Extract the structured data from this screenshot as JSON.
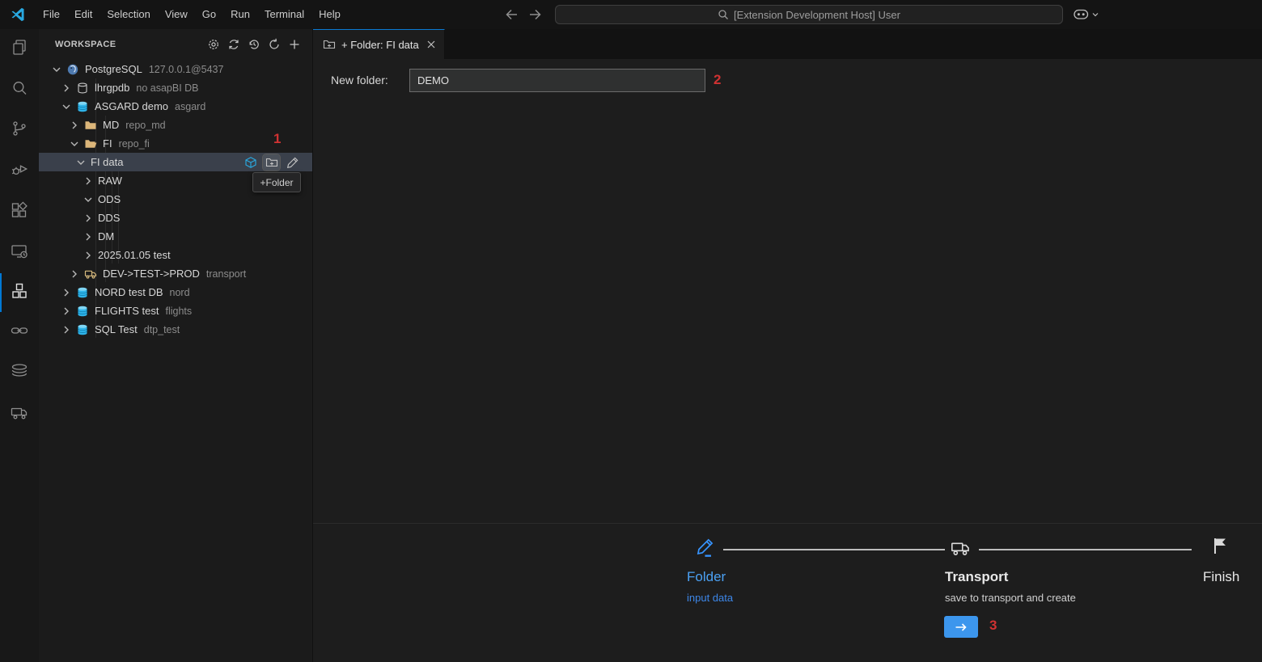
{
  "titlebar": {
    "menu": [
      "File",
      "Edit",
      "Selection",
      "View",
      "Go",
      "Run",
      "Terminal",
      "Help"
    ],
    "command_center": "[Extension Development Host] User",
    "icons": [
      "vscode-logo",
      "back-arrow",
      "forward-arrow",
      "search",
      "copilot",
      "chevron-down"
    ]
  },
  "activity_bar": {
    "icons": [
      "explorer",
      "search",
      "source-control",
      "run-and-debug",
      "extensions",
      "remote-explorer",
      "cubes-extension",
      "link",
      "data-layers",
      "transport-truck"
    ],
    "active": "cubes-extension"
  },
  "sidebar": {
    "title": "WORKSPACE",
    "toolbar_icons": [
      "settings-gear",
      "sync",
      "history",
      "refresh",
      "add"
    ],
    "tooltip": "+Folder",
    "selected_row_actions": [
      "cube",
      "new-folder",
      "edit-pencil"
    ],
    "tree": [
      {
        "level": 0,
        "chevron": "down",
        "icon": "postgres",
        "label": "PostgreSQL",
        "description": "127.0.0.1@5437",
        "selected": false
      },
      {
        "level": 1,
        "chevron": "right",
        "icon": "db-outline",
        "label": "lhrgpdb",
        "description": "no asapBI DB",
        "selected": false
      },
      {
        "level": 1,
        "chevron": "down",
        "icon": "db",
        "label": "ASGARD demo",
        "description": "asgard",
        "selected": false
      },
      {
        "level": 2,
        "chevron": "right",
        "icon": "folder",
        "label": "MD",
        "description": "repo_md",
        "selected": false
      },
      {
        "level": 2,
        "chevron": "down",
        "icon": "folder-open",
        "label": "FI",
        "description": "repo_fi",
        "selected": false
      },
      {
        "level": 3,
        "chevron": "down",
        "icon": null,
        "label": "FI data",
        "description": "",
        "selected": true
      },
      {
        "level": 4,
        "chevron": "right",
        "icon": null,
        "label": "RAW",
        "description": "",
        "selected": false
      },
      {
        "level": 4,
        "chevron": "down",
        "icon": null,
        "label": "ODS",
        "description": "",
        "selected": false
      },
      {
        "level": 4,
        "chevron": "right",
        "icon": null,
        "label": "DDS",
        "description": "",
        "selected": false
      },
      {
        "level": 4,
        "chevron": "right",
        "icon": null,
        "label": "DM",
        "description": "",
        "selected": false
      },
      {
        "level": 4,
        "chevron": "right",
        "icon": null,
        "label": "2025.01.05 test",
        "description": "",
        "selected": false
      },
      {
        "level": 2,
        "chevron": "right",
        "icon": "truck",
        "label": "DEV->TEST->PROD",
        "description": "transport",
        "selected": false
      },
      {
        "level": 1,
        "chevron": "right",
        "icon": "db",
        "label": "NORD test DB",
        "description": "nord",
        "selected": false
      },
      {
        "level": 1,
        "chevron": "right",
        "icon": "db",
        "label": "FLIGHTS test",
        "description": "flights",
        "selected": false
      },
      {
        "level": 1,
        "chevron": "right",
        "icon": "db",
        "label": "SQL Test",
        "description": "dtp_test",
        "selected": false
      }
    ]
  },
  "editor": {
    "tab": {
      "icon": "new-folder",
      "label": "+ Folder: FI data"
    },
    "form": {
      "label": "New folder:",
      "value": "DEMO"
    }
  },
  "wizard": {
    "steps": [
      {
        "icon": "pencil",
        "title": "Folder",
        "subtitle": "input data"
      },
      {
        "icon": "truck",
        "title": "Transport",
        "subtitle": "save to transport and create"
      },
      {
        "icon": "flag",
        "title": "Finish",
        "subtitle": ""
      }
    ],
    "next_icon": "arrow-right"
  },
  "annotations": {
    "folder_row": "1",
    "input": "2",
    "next_button": "3"
  },
  "colors": {
    "accent_blue": "#3794ff",
    "button_blue": "#3c96ed",
    "tab_top_border": "#0a7ad4",
    "annotation_red": "#d03232",
    "db_cyan": "#2fb4e9",
    "folder_yellow": "#dcb67a",
    "stepper_line": "#bdbdbd"
  }
}
